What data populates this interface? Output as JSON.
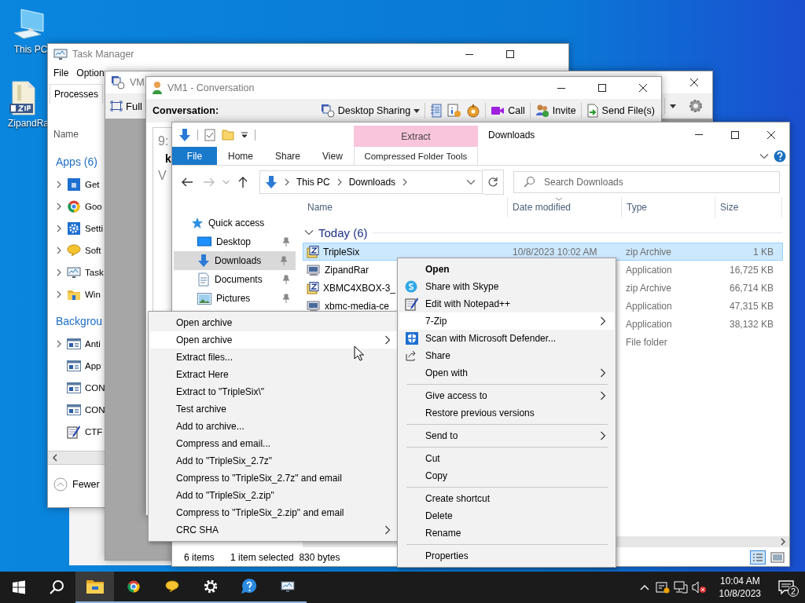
{
  "desktop_icons": [
    {
      "label": "This PC"
    },
    {
      "label": "ZipandRa"
    }
  ],
  "task_manager": {
    "title": "Task Manager",
    "menu": [
      "File",
      "Option"
    ],
    "tabs": [
      {
        "label": "Processes",
        "selected": true
      }
    ],
    "column": "Name",
    "groups": [
      {
        "title": "Apps (6)",
        "items": [
          {
            "label": "Get",
            "expandable": true
          },
          {
            "label": "Goo",
            "expandable": true
          },
          {
            "label": "Setti",
            "expandable": true
          },
          {
            "label": "Soft",
            "expandable": true
          },
          {
            "label": "Task",
            "expandable": true
          },
          {
            "label": "Win",
            "expandable": true
          }
        ]
      },
      {
        "title": "Backgrou",
        "items": [
          {
            "label": "Anti",
            "expandable": true
          },
          {
            "label": "App",
            "expandable": false
          },
          {
            "label": "CON",
            "expandable": false
          },
          {
            "label": "CON",
            "expandable": false
          },
          {
            "label": "CTF",
            "expandable": false
          }
        ]
      }
    ],
    "footer": "Fewer"
  },
  "vm6": {
    "title": "VM",
    "toolbar": [
      "Full"
    ]
  },
  "vm1": {
    "title": "VM1 - Conversation",
    "toolbar_label": "Conversation:",
    "tool_groups": [
      [
        {
          "label": "Desktop Sharing",
          "dropdown": true
        }
      ],
      [
        {
          "dropdown": false
        },
        {
          "dropdown": false
        },
        {
          "dropdown": false
        }
      ],
      [
        {
          "label": "Call",
          "dropdown": false
        }
      ],
      [
        {
          "label": "Invite",
          "dropdown": false
        }
      ],
      [
        {
          "label": "Send File(s)",
          "dropdown": false
        }
      ]
    ],
    "transcript": [
      {
        "text": "9:",
        "bold": false
      },
      {
        "text": "k",
        "bold": true
      },
      {
        "text": "V",
        "bold": false
      }
    ]
  },
  "explorer": {
    "title": "Downloads",
    "tool_tab": "Extract",
    "ribbon_tabs": [
      {
        "label": "File",
        "kind": "file"
      },
      {
        "label": "Home",
        "kind": "tab"
      },
      {
        "label": "Share",
        "kind": "tab"
      },
      {
        "label": "View",
        "kind": "tab"
      },
      {
        "label": "Compressed Folder Tools",
        "kind": "tool"
      }
    ],
    "breadcrumb": [
      "This PC",
      "Downloads"
    ],
    "search": {
      "placeholder": "Search Downloads"
    },
    "nav": [
      {
        "label": "Quick access",
        "selected": false,
        "children": [
          {
            "label": "Desktop",
            "selected": false,
            "pinned": true
          },
          {
            "label": "Downloads",
            "selected": true,
            "pinned": true
          },
          {
            "label": "Documents",
            "selected": false,
            "pinned": true
          },
          {
            "label": "Pictures",
            "selected": false,
            "pinned": true
          }
        ]
      }
    ],
    "columns": [
      "Name",
      "Date modified",
      "Type",
      "Size"
    ],
    "group": {
      "title": "Today (6)",
      "expanded": true
    },
    "rows": [
      {
        "name": "TripleSix",
        "kind": "zip",
        "date": "10/8/2023 10:02 AM",
        "type": "zip Archive",
        "size": "1 KB",
        "selected": true
      },
      {
        "name": "ZipandRar",
        "kind": "app",
        "type": "Application",
        "size": "16,725 KB",
        "selected": false
      },
      {
        "name": "XBMC4XBOX-3_",
        "kind": "zip",
        "type": "zip Archive",
        "size": "66,714 KB",
        "selected": false
      },
      {
        "name": "xbmc-media-ce",
        "kind": "app",
        "type": "Application",
        "size": "47,315 KB",
        "selected": false
      },
      {
        "type": "Application",
        "size": "38,132 KB",
        "selected": false
      },
      {
        "type": "File folder",
        "selected": false
      }
    ],
    "status": {
      "items": "6 items",
      "selection": "1 item selected  830 bytes"
    }
  },
  "context_menu": {
    "sections": [
      [
        {
          "label": "Open",
          "default": true,
          "selected": false,
          "submenu": false
        },
        {
          "label": "Share with Skype",
          "default": false,
          "selected": false,
          "submenu": false
        },
        {
          "label": "Edit with Notepad++",
          "default": false,
          "selected": false,
          "submenu": false
        },
        {
          "label": "7-Zip",
          "default": false,
          "selected": true,
          "submenu": true
        },
        {
          "label": "Scan with Microsoft Defender...",
          "default": false,
          "selected": false,
          "submenu": false
        },
        {
          "label": "Share",
          "default": false,
          "selected": false,
          "submenu": false
        },
        {
          "label": "Open with",
          "default": false,
          "selected": false,
          "submenu": true
        }
      ],
      [
        {
          "label": "Give access to",
          "default": false,
          "selected": false,
          "submenu": true
        },
        {
          "label": "Restore previous versions",
          "default": false,
          "selected": false,
          "submenu": false
        }
      ],
      [
        {
          "label": "Send to",
          "default": false,
          "selected": false,
          "submenu": true
        }
      ],
      [
        {
          "label": "Cut",
          "default": false,
          "selected": false,
          "submenu": false
        },
        {
          "label": "Copy",
          "default": false,
          "selected": false,
          "submenu": false
        }
      ],
      [
        {
          "label": "Create shortcut",
          "default": false,
          "selected": false,
          "submenu": false
        },
        {
          "label": "Delete",
          "default": false,
          "selected": false,
          "submenu": false
        },
        {
          "label": "Rename",
          "default": false,
          "selected": false,
          "submenu": false
        }
      ],
      [
        {
          "label": "Properties",
          "default": false,
          "selected": false,
          "submenu": false
        }
      ]
    ]
  },
  "submenu": {
    "items": [
      {
        "label": "Open archive",
        "selected": false,
        "submenu": false
      },
      {
        "label": "Open archive",
        "selected": true,
        "submenu": true
      },
      {
        "label": "Extract files...",
        "selected": false,
        "submenu": false
      },
      {
        "label": "Extract Here",
        "selected": false,
        "submenu": false
      },
      {
        "label": "Extract to \"TripleSix\\\"",
        "selected": false,
        "submenu": false
      },
      {
        "label": "Test archive",
        "selected": false,
        "submenu": false
      },
      {
        "label": "Add to archive...",
        "selected": false,
        "submenu": false
      },
      {
        "label": "Compress and email...",
        "selected": false,
        "submenu": false
      },
      {
        "label": "Add to \"TripleSix_2.7z\"",
        "selected": false,
        "submenu": false
      },
      {
        "label": "Compress to \"TripleSix_2.7z\" and email",
        "selected": false,
        "submenu": false
      },
      {
        "label": "Add to \"TripleSix_2.zip\"",
        "selected": false,
        "submenu": false
      },
      {
        "label": "Compress to \"TripleSix_2.zip\" and email",
        "selected": false,
        "submenu": false
      },
      {
        "label": "CRC SHA",
        "selected": false,
        "submenu": true
      }
    ]
  },
  "taskbar": {
    "apps": [
      {
        "active": true,
        "running": true
      },
      {
        "active": false,
        "running": true
      },
      {
        "active": false,
        "running": true
      },
      {
        "active": false,
        "running": true
      },
      {
        "active": false,
        "running": true
      },
      {
        "active": false,
        "running": true
      }
    ],
    "clock": {
      "time": "10:04 AM",
      "date": "10/8/2023"
    },
    "notifications": "2"
  }
}
